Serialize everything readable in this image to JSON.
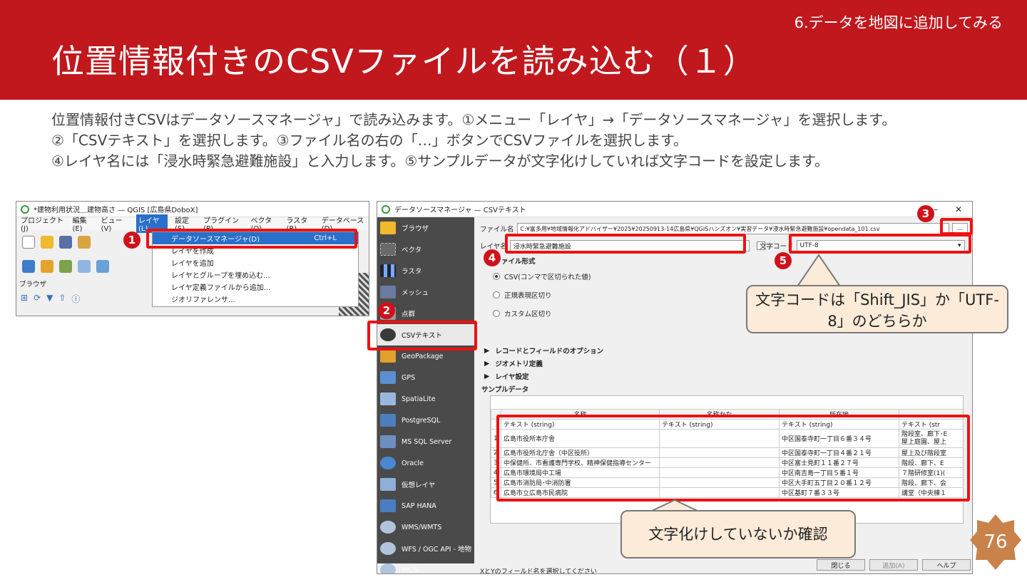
{
  "header": {
    "section": "6.データを地図に追加してみる",
    "title": "位置情報付きのCSVファイルを読み込む（１）"
  },
  "body": {
    "lines": [
      "位置情報付きCSVはデータソースマネージャ」で読み込みます。①メニュー「レイヤ」→「データソースマネージャ」を選択します。",
      "②「CSVテキスト」を選択します。③ファイル名の右の「…」ボタンでCSVファイルを選択します。",
      "④レイヤ名には「浸水時緊急避難施設」と入力します。⑤サンプルデータが文字化けしていれば文字コードを設定します。"
    ]
  },
  "qgis": {
    "title": "*建物利用状況＿建物高さ — QGIS [広島県DoboX]",
    "menus": [
      "プロジェクト(J)",
      "編集(E)",
      "ビュー(V)",
      "レイヤ(L)",
      "設定(S)",
      "プラグイン(P)",
      "ベクタ(O)",
      "ラスタ(R)",
      "データベース(D)"
    ],
    "browser_label": "ブラウザ",
    "dropdown": {
      "items": [
        "データソースマネージャ(D)",
        "レイヤを作成",
        "レイヤを追加",
        "レイヤとグループを埋め込む...",
        "レイヤ定義ファイルから追加...",
        "ジオリファレンサ..."
      ],
      "shortcut": "Ctrl+L"
    }
  },
  "dsm": {
    "title": "データソースマネージャ — CSVテキスト",
    "sidebar": [
      "ブラウザ",
      "ベクタ",
      "ラスタ",
      "メッシュ",
      "点群",
      "CSVテキスト",
      "GeoPackage",
      "GPS",
      "SpatiaLite",
      "PostgreSQL",
      "MS SQL Server",
      "Oracle",
      "仮想レイヤ",
      "SAP HANA",
      "WMS/WMTS",
      "WFS / OGC API - 地物",
      "WCS"
    ],
    "file_label": "ファイル名",
    "file_value": "C:¥富多用¥地域情報化アドバイザー¥2025¥20250913-14広島県¥QGISハンズオン¥実習データ¥浸水時緊急避難施設¥opendata_101.csv",
    "browse_label": "…",
    "layer_label": "レイヤ名",
    "layer_value": "浸水時緊急避難施設",
    "encoding_label": "文字コード",
    "encoding_value": "UTF-8",
    "format_heading": "ァイル形式",
    "formats": [
      "CSV(コンマで区切られた値)",
      "正規表現区切り",
      "カスタム区切り"
    ],
    "sections": [
      "レコードとフィールドのオプション",
      "ジオメトリ定義",
      "レイヤ設定"
    ],
    "sample_label": "サンプルデータ",
    "columns": [
      "名称",
      "名称かな",
      "所在地",
      ""
    ],
    "types": [
      "テキスト (string)",
      "テキスト (string)",
      "テキスト (string)",
      "テキスト (str"
    ],
    "rows": [
      [
        "1",
        "広島市役所本庁舎",
        "",
        "中区国泰寺町一丁目６番３４号",
        "階段室、廊下･E"
      ],
      [
        "2",
        "広島市役所北庁舎（中区役所）",
        "",
        "中区国泰寺町一丁目４番２１号",
        "屋上及び階段室"
      ],
      [
        "3",
        "中保健所、市看護専門学校、精神保健指導センター",
        "",
        "中区富士見町１１番２７号",
        "階段、廊下、E"
      ],
      [
        "4",
        "広島市環境局中工場",
        "",
        "中区南吉島一丁目５番１号",
        "７階研修室(1)("
      ],
      [
        "5",
        "広島市消防局･中消防署",
        "",
        "中区大手町五丁目２０番１２号",
        "階段、廊下、会"
      ],
      [
        "6",
        "広島市立広島市民病院",
        "",
        "中区基町７番３３号",
        "講堂（中央棟１"
      ]
    ],
    "row1_extra": "屋上庭園、屋上",
    "bottom_note": "XとYのフィールド名を選択してください",
    "buttons": [
      "閉じる",
      "追加(A)",
      "ヘルプ"
    ]
  },
  "callouts": {
    "encoding": "文字コードは「Shift_JIS」か「UTF-8」のどちらか",
    "check": "文字化けしていないか確認"
  },
  "markers": [
    "1",
    "2",
    "3",
    "4",
    "5"
  ],
  "page_number": "76",
  "colors": {
    "header": "#c0181d",
    "marker": "#d0111b",
    "callout": "#fcebd9",
    "badge": "#c8824a"
  }
}
